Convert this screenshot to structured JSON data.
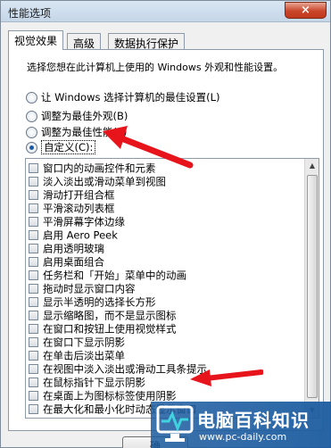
{
  "window": {
    "title": "性能选项",
    "close_label": "×"
  },
  "tabs": [
    {
      "label": "视觉效果"
    },
    {
      "label": "高级"
    },
    {
      "label": "数据执行保护"
    }
  ],
  "intro_text": "选择您想在此计算机上使用的 Windows 外观和性能设置。",
  "radio_options": [
    {
      "label": "让 Windows 选择计算机的最佳设置(L)",
      "checked": false
    },
    {
      "label": "调整为最佳外观(B)",
      "checked": false
    },
    {
      "label": "调整为最佳性能(P)",
      "checked": false
    },
    {
      "label": "自定义(C):",
      "checked": true
    }
  ],
  "effects": [
    "窗口内的动画控件和元素",
    "淡入淡出或滑动菜单到视图",
    "滑动打开组合框",
    "平滑滚动列表框",
    "平滑屏幕字体边缘",
    "启用 Aero Peek",
    "启用透明玻璃",
    "启用桌面组合",
    "任务栏和「开始」菜单中的动画",
    "拖动时显示窗口内容",
    "显示半透明的选择长方形",
    "显示缩略图，而不是显示图标",
    "在窗口和按钮上使用视觉样式",
    "在窗口下显示阴影",
    "在单击后淡出菜单",
    "在视图中淡入淡出或滑动工具条提示",
    "在鼠标指针下显示阴影",
    "在桌面上为图标标签使用阴影",
    "在最大化和最小化时动态显示窗口"
  ],
  "buttons": {
    "ok": "确"
  },
  "watermark": {
    "title": "电脑百科知识",
    "url": "www.pc-daily.com"
  },
  "colors": {
    "accent": "#1d5aa5",
    "arrow": "#e8141c",
    "close": "#c9462b"
  }
}
